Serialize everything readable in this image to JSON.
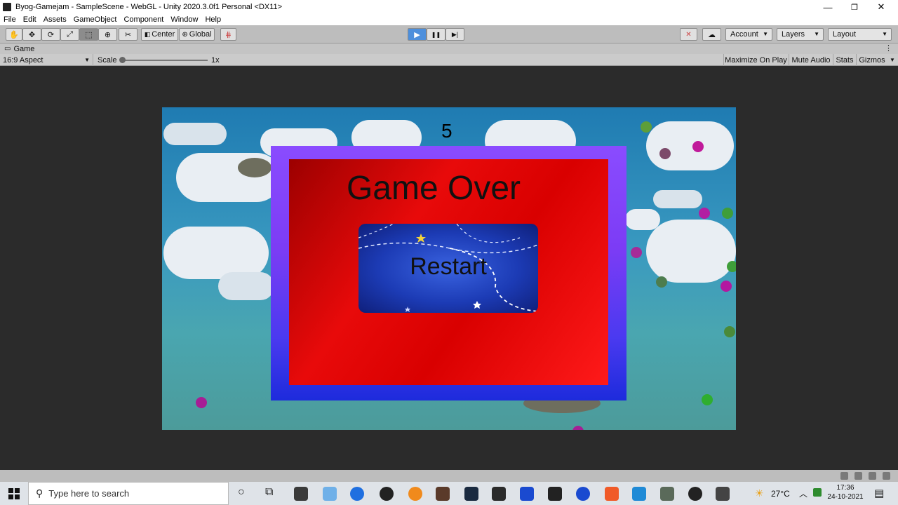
{
  "window": {
    "title": "Byog-Gamejam - SampleScene - WebGL - Unity 2020.3.0f1 Personal <DX11>",
    "controls": {
      "minimize": "—",
      "maximize": "❐",
      "close": "✕"
    }
  },
  "menu": [
    "File",
    "Edit",
    "Assets",
    "GameObject",
    "Component",
    "Window",
    "Help"
  ],
  "toolbar": {
    "pivot_label": "Center",
    "space_label": "Global",
    "account_label": "Account",
    "layers_label": "Layers",
    "layout_label": "Layout",
    "play_icon": "▶",
    "pause_icon": "❚❚",
    "step_icon": "▶|"
  },
  "game_tab": {
    "label": "Game"
  },
  "game_bar": {
    "aspect": "16:9 Aspect",
    "scale_label": "Scale",
    "scale_value": "1x",
    "options": [
      "Maximize On Play",
      "Mute Audio",
      "Stats",
      "Gizmos"
    ]
  },
  "game": {
    "score": "5",
    "game_over_title": "Game Over",
    "restart_label": "Restart"
  },
  "taskbar": {
    "search_placeholder": "Type here to search",
    "temperature": "27°C",
    "time": "17:36",
    "date": "24-10-2021"
  },
  "colors": {
    "panel_outer": "#7c3cf5",
    "panel_inner": "#e00000",
    "restart_button": "#1c3bb5",
    "play_active": "#4d8fdc"
  }
}
